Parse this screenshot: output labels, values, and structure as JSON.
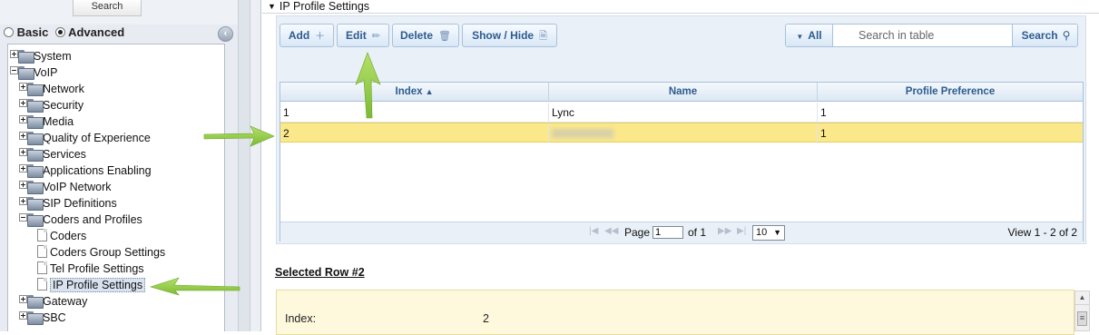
{
  "left_nav": {
    "search_label": "Search",
    "mode": {
      "basic_label": "Basic",
      "advanced_label": "Advanced",
      "selected": "Advanced"
    },
    "tree": [
      {
        "label": "System",
        "type": "folder",
        "expanded": false
      },
      {
        "label": "VoIP",
        "type": "folder",
        "expanded": true
      },
      {
        "label": "Network",
        "type": "folder",
        "expanded": false
      },
      {
        "label": "Security",
        "type": "folder",
        "expanded": false
      },
      {
        "label": "Media",
        "type": "folder",
        "expanded": false
      },
      {
        "label": "Quality of Experience",
        "type": "folder",
        "expanded": false
      },
      {
        "label": "Services",
        "type": "folder",
        "expanded": false
      },
      {
        "label": "Applications Enabling",
        "type": "folder",
        "expanded": false
      },
      {
        "label": "VoIP Network",
        "type": "folder",
        "expanded": false
      },
      {
        "label": "SIP Definitions",
        "type": "folder",
        "expanded": false
      },
      {
        "label": "Coders and Profiles",
        "type": "folder",
        "expanded": true
      },
      {
        "label": "Coders",
        "type": "page"
      },
      {
        "label": "Coders Group Settings",
        "type": "page"
      },
      {
        "label": "Tel Profile Settings",
        "type": "page"
      },
      {
        "label": "IP Profile Settings",
        "type": "page",
        "selected": true
      },
      {
        "label": "Gateway",
        "type": "folder",
        "expanded": false
      },
      {
        "label": "SBC",
        "type": "folder",
        "expanded": false
      }
    ]
  },
  "main": {
    "title": "IP Profile Settings",
    "toolbar": {
      "add_label": "Add",
      "edit_label": "Edit",
      "delete_label": "Delete",
      "showhide_label": "Show / Hide",
      "all_label": "All",
      "search_placeholder": "Search in table",
      "search_label": "Search"
    },
    "table": {
      "columns": [
        "Index",
        "Name",
        "Profile Preference"
      ],
      "sort_column": "Index",
      "rows": [
        {
          "index": "1",
          "name": "Lync",
          "profile_preference": "1"
        },
        {
          "index": "2",
          "name": "",
          "profile_preference": "1",
          "selected": true,
          "name_obscured": true
        }
      ]
    },
    "pager": {
      "page_label": "Page",
      "page_value": "1",
      "of_label": "of 1",
      "rows_per_page": "10",
      "view_label": "View 1 - 2 of 2"
    },
    "selected_row": {
      "title": "Selected Row #2",
      "fields": [
        {
          "key": "Index:",
          "value": "2"
        }
      ]
    }
  },
  "colors": {
    "arrow": "#8cc63f",
    "selected_row": "#fae88b",
    "button_text": "#2e5c8f",
    "panel_bg": "#e9f0f8"
  }
}
